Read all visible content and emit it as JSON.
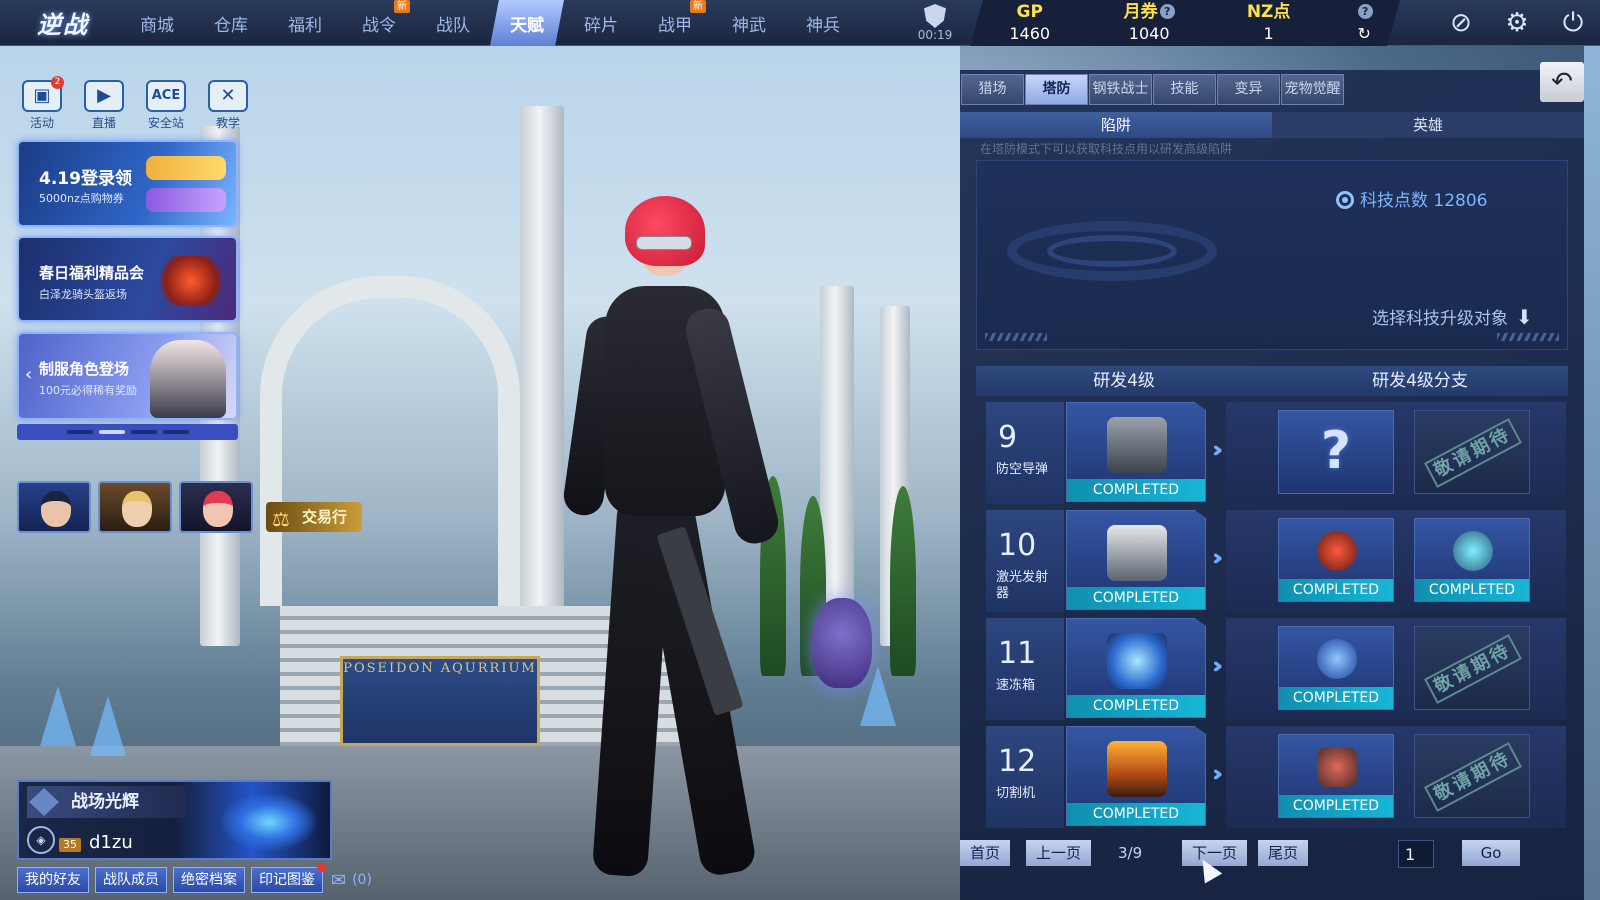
{
  "app": {
    "logo": "逆战"
  },
  "nav": {
    "tabs": [
      {
        "label": "商城",
        "badge": ""
      },
      {
        "label": "仓库",
        "badge": ""
      },
      {
        "label": "福利",
        "badge": ""
      },
      {
        "label": "战令",
        "badge": "新"
      },
      {
        "label": "战队",
        "badge": ""
      },
      {
        "label": "天赋",
        "badge": "",
        "active": true
      },
      {
        "label": "碎片",
        "badge": ""
      },
      {
        "label": "战甲",
        "badge": "新"
      },
      {
        "label": "神武",
        "badge": ""
      },
      {
        "label": "神兵",
        "badge": ""
      }
    ]
  },
  "timer": "00:19",
  "currency": {
    "gp_label": "GP",
    "gp_value": "1460",
    "coupon_label": "月券",
    "coupon_value": "1040",
    "nz_label": "NZ点",
    "nz_value": "1",
    "help": "?"
  },
  "quick": [
    {
      "label": "活动",
      "badge": "2",
      "icon": "gift-icon"
    },
    {
      "label": "直播",
      "icon": "tv-icon"
    },
    {
      "label": "安全站",
      "icon": "ace-icon"
    },
    {
      "label": "教学",
      "icon": "teach-icon"
    }
  ],
  "banners": [
    {
      "title": "4.19登录领",
      "sub": "5000nz点购物券"
    },
    {
      "title": "春日福利精品会",
      "sub": "白泽龙骑头盔返场"
    },
    {
      "title": "制服角色登场",
      "sub": "100元必得稀有奖励"
    }
  ],
  "trade": {
    "label": "交易行"
  },
  "scene": {
    "plaque": "POSEIDON AQURRIUM"
  },
  "player": {
    "title": "战场光辉",
    "level": "35",
    "name": "d1zu"
  },
  "bottom_buttons": [
    "我的好友",
    "战队成员",
    "绝密档案",
    "印记图鉴"
  ],
  "mail_count": "(0)",
  "panel": {
    "tabs": [
      "猎场",
      "塔防",
      "钢铁战士",
      "技能",
      "变异",
      "宠物觉醒"
    ],
    "active_tab": "塔防",
    "subtabs": [
      "陷阱",
      "英雄"
    ],
    "hint": "在塔防模式下可以获取科技点用以研发高级陷阱",
    "tech_points": "科技点数 12806",
    "select_target": "选择科技升级对象",
    "rd_header": [
      "研发4级",
      "研发4级分支"
    ],
    "rows": [
      {
        "num": "9",
        "name": "防空导弹",
        "status": "COMPLETED",
        "branch": [
          {
            "type": "unknown",
            "text": "?"
          },
          {
            "type": "locked",
            "text": "敬请期待"
          }
        ]
      },
      {
        "num": "10",
        "name": "激光发射器",
        "status": "COMPLETED",
        "branch": [
          {
            "type": "done",
            "text": "COMPLETED"
          },
          {
            "type": "done",
            "text": "COMPLETED"
          }
        ]
      },
      {
        "num": "11",
        "name": "速冻箱",
        "status": "COMPLETED",
        "branch": [
          {
            "type": "done",
            "text": "COMPLETED"
          },
          {
            "type": "locked",
            "text": "敬请期待"
          }
        ]
      },
      {
        "num": "12",
        "name": "切割机",
        "status": "COMPLETED",
        "branch": [
          {
            "type": "done",
            "text": "COMPLETED"
          },
          {
            "type": "locked",
            "text": "敬请期待"
          }
        ]
      }
    ],
    "pager": {
      "first": "首页",
      "prev": "上一页",
      "indicator": "3/9",
      "next": "下一页",
      "last": "尾页",
      "input": "1",
      "go": "Go"
    }
  },
  "colors": {
    "accent": "#19b6d6",
    "nav_active": "#5d7fd6",
    "currency": "#ffe14a"
  }
}
